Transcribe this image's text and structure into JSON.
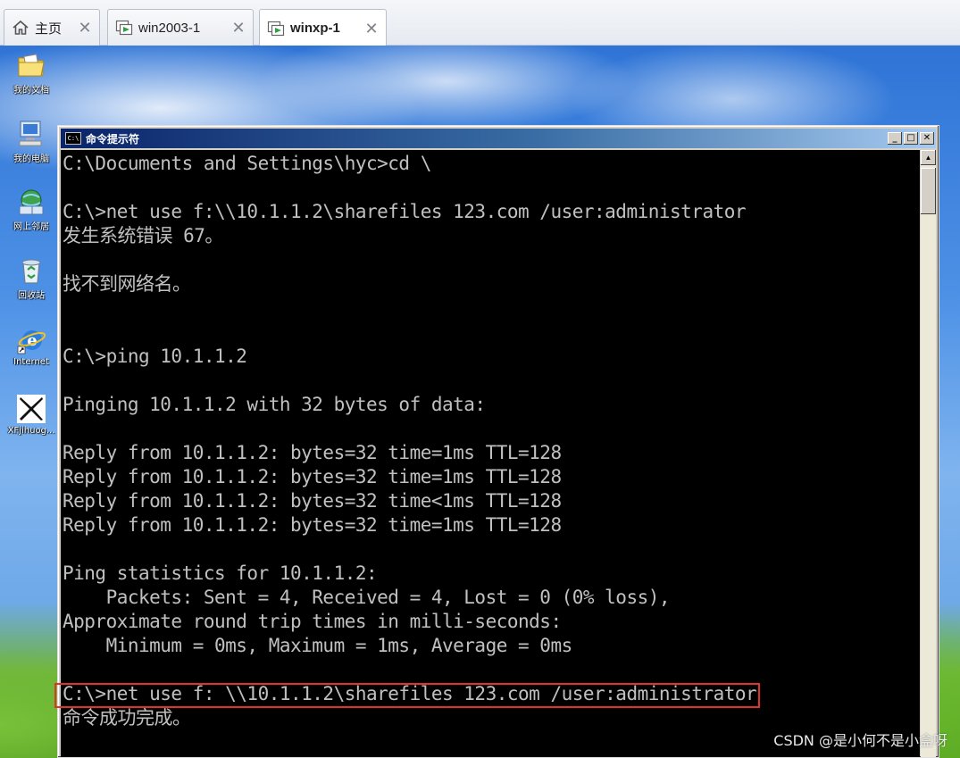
{
  "tabs": [
    {
      "label": "主页",
      "icon": "home-icon",
      "active": false
    },
    {
      "label": "win2003-1",
      "icon": "vm-icon",
      "active": false
    },
    {
      "label": "winxp-1",
      "icon": "vm-icon",
      "active": true
    }
  ],
  "tab_close_glyph": "✕",
  "desktop_icons": [
    {
      "label": "我的文档",
      "icon": "folder-documents-icon"
    },
    {
      "label": "我的电脑",
      "icon": "my-computer-icon"
    },
    {
      "label": "网上邻居",
      "icon": "network-places-icon"
    },
    {
      "label": "回收站",
      "icon": "recycle-bin-icon"
    },
    {
      "label": "Internet",
      "icon": "internet-explorer-icon"
    },
    {
      "label": "XFjihuog...",
      "icon": "app-x-icon"
    }
  ],
  "cmd_window": {
    "title": "命令提示符",
    "icon_text": "C:\\",
    "lines": [
      "C:\\Documents and Settings\\hyc>cd \\",
      "",
      "C:\\>net use f:\\\\10.1.1.2\\sharefiles 123.com /user:administrator",
      "发生系统错误 67。",
      "",
      "找不到网络名。",
      "",
      "",
      "C:\\>ping 10.1.1.2",
      "",
      "Pinging 10.1.1.2 with 32 bytes of data:",
      "",
      "Reply from 10.1.1.2: bytes=32 time=1ms TTL=128",
      "Reply from 10.1.1.2: bytes=32 time=1ms TTL=128",
      "Reply from 10.1.1.2: bytes=32 time<1ms TTL=128",
      "Reply from 10.1.1.2: bytes=32 time=1ms TTL=128",
      "",
      "Ping statistics for 10.1.1.2:",
      "    Packets: Sent = 4, Received = 4, Lost = 0 (0% loss),",
      "Approximate round trip times in milli-seconds:",
      "    Minimum = 0ms, Maximum = 1ms, Average = 0ms",
      "",
      "C:\\>net use f: \\\\10.1.1.2\\sharefiles 123.com /user:administrator",
      "命令成功完成。"
    ]
  },
  "watermark": "CSDN @是小何不是小盒呀",
  "colors": {
    "console_bg": "#000000",
    "console_fg": "#c0c0c0",
    "highlight": "#e2332b",
    "titlebar_start": "#0a246a"
  }
}
